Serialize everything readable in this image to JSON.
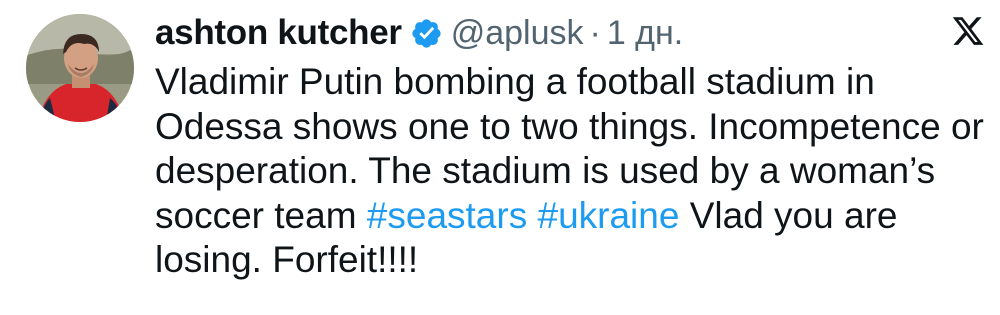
{
  "author": {
    "display_name": "ashton kutcher",
    "handle": "@aplusk",
    "separator": "·",
    "timestamp": "1 дн."
  },
  "tweet": {
    "text_segments": [
      "Vladimir Putin bombing a football stadium in Odessa shows one to two things. Incompetence or desperation. The stadium is used by a woman’s soccer team ",
      " ",
      " Vlad you are losing. Forfeit!!!!"
    ],
    "hashtags": [
      "#seastars",
      "#ukraine"
    ]
  },
  "icons": {
    "verified": "verified-badge-icon",
    "brand": "x-logo-icon"
  },
  "colors": {
    "text_primary": "#0f1419",
    "text_secondary": "#536471",
    "link": "#1d9bf0",
    "verified": "#1d9bf0"
  }
}
